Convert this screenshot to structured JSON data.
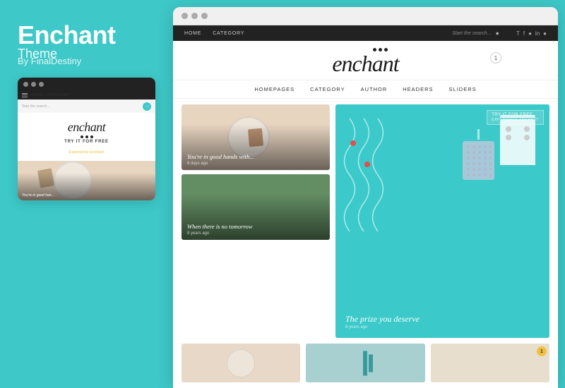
{
  "left": {
    "title": "Enchant",
    "subtitle": "Theme",
    "author": "By FinalDestiny"
  },
  "mini_preview": {
    "nav_links": [
      "HOME",
      "CATEGORY"
    ],
    "search_placeholder": "Start the search...",
    "logo": "enchant",
    "try_btn": "TRY IT FOR FREE",
    "experience": "Experience Enchant",
    "article_caption": "You're in good han..."
  },
  "site": {
    "nav_links": [
      "HOME",
      "CATEGORY"
    ],
    "search_placeholder": "Start the search...",
    "logo": "enchant",
    "notification": "1",
    "main_nav": [
      "HOMEPAGES",
      "CATEGORY",
      "AUTHOR",
      "HEADERS",
      "SLIDERS"
    ],
    "social_icons": [
      "twitter",
      "facebook",
      "instagram",
      "linkedin",
      "pinterest"
    ],
    "articles": [
      {
        "title": "You're in good hands with...",
        "meta": "6 days ago",
        "image_bg": "#e8d8c4"
      },
      {
        "title": "When there is no tomorrow",
        "meta": "8 years ago",
        "image_bg": "#6a8a5a"
      },
      {
        "title": "The prize you deserve",
        "meta": "8 years ago",
        "image_bg": "#3ec8c8"
      }
    ],
    "try_free": "TRY IT FOR FREE",
    "experience_enchant": "Experience Enchant",
    "bottom_badge": "1"
  },
  "browser": {
    "dots": [
      "•",
      "•",
      "•"
    ]
  }
}
